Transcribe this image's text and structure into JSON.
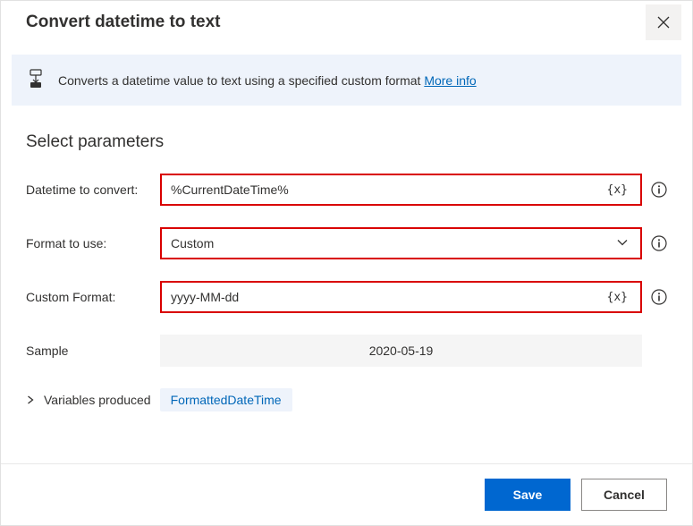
{
  "header": {
    "title": "Convert datetime to text"
  },
  "banner": {
    "text": "Converts a datetime value to text using a specified custom format ",
    "link": "More info"
  },
  "section_title": "Select parameters",
  "fields": {
    "datetime": {
      "label": "Datetime to convert:",
      "value": "%CurrentDateTime%",
      "var_token": "{x}"
    },
    "format": {
      "label": "Format to use:",
      "value": "Custom"
    },
    "custom": {
      "label": "Custom Format:",
      "value": "yyyy-MM-dd",
      "var_token": "{x}"
    },
    "sample": {
      "label": "Sample",
      "value": "2020-05-19"
    }
  },
  "variables": {
    "label": "Variables produced",
    "chip": "FormattedDateTime"
  },
  "footer": {
    "save": "Save",
    "cancel": "Cancel"
  }
}
